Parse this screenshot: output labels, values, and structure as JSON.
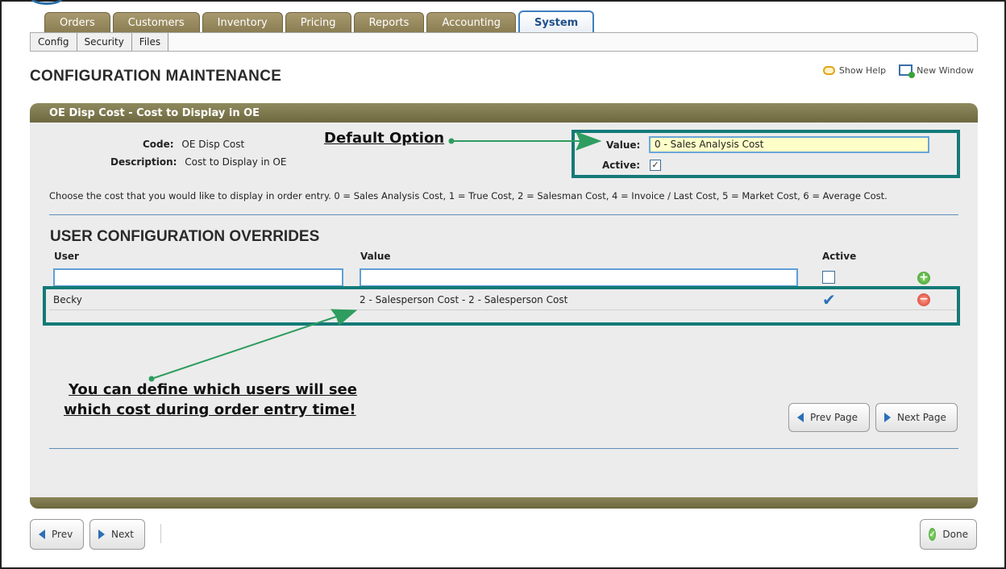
{
  "tabs": [
    "Orders",
    "Customers",
    "Inventory",
    "Pricing",
    "Reports",
    "Accounting",
    "System"
  ],
  "active_tab": "System",
  "subtabs": [
    "Config",
    "Security",
    "Files"
  ],
  "page_title": "CONFIGURATION MAINTENANCE",
  "toplinks": {
    "help": "Show Help",
    "new_window": "New Window"
  },
  "panel": {
    "header": "OE Disp Cost - Cost to Display in OE",
    "code_label": "Code:",
    "code_value": "OE Disp Cost",
    "description_label": "Description:",
    "description_value": "Cost to Display in OE",
    "value_label": "Value:",
    "value_input": "0 - Sales Analysis Cost",
    "active_label": "Active:",
    "active_checked": true,
    "help_text": "Choose the cost that you would like to display in order entry. 0 = Sales Analysis Cost, 1 = True Cost, 2 = Salesman Cost, 4 = Invoice / Last Cost, 5 = Market Cost, 6 = Average Cost."
  },
  "overrides": {
    "title": "USER CONFIGURATION OVERRIDES",
    "columns": {
      "user": "User",
      "value": "Value",
      "active": "Active"
    },
    "rows": [
      {
        "user": "Becky",
        "value": "2 - Salesperson Cost - 2 - Salesperson Cost",
        "active": true
      }
    ]
  },
  "annotations": {
    "default_option": "Default Option",
    "users_line1": "You can define which users will see",
    "users_line2": "which cost during order entry time!"
  },
  "pager": {
    "prev": "Prev Page",
    "next": "Next Page"
  },
  "bottom": {
    "prev": "Prev",
    "next": "Next",
    "done": "Done"
  },
  "colors": {
    "callout_border": "#147a78",
    "arrow": "#2e9d5f",
    "panel_header": "#7c774b",
    "active_tab_border": "#3f7fbf"
  }
}
